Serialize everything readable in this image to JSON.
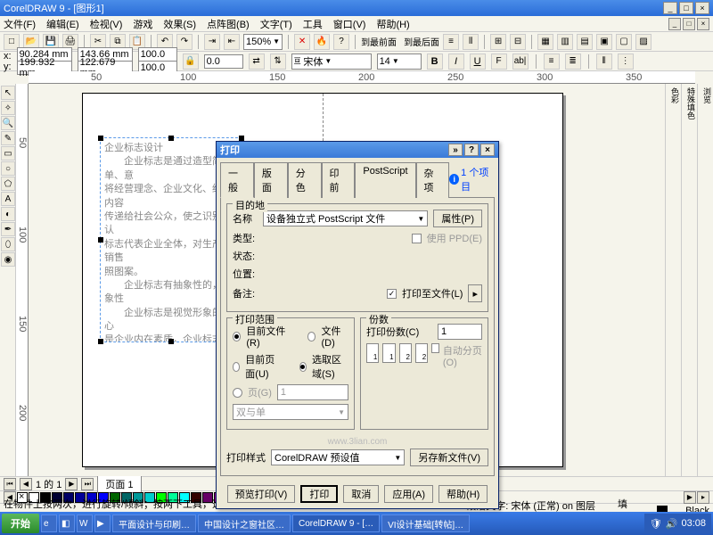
{
  "title": "CorelDRAW 9 - [图形1]",
  "menu": [
    "文件(F)",
    "编辑(E)",
    "检视(V)",
    "游戏",
    "效果(S)",
    "点阵图(B)",
    "文字(T)",
    "工具",
    "窗口(V)",
    "帮助(H)"
  ],
  "toolbar": {
    "zoom": "150%"
  },
  "toolbar2": {
    "t1": "到最前面",
    "t2": "到最后面"
  },
  "prop": {
    "x": "90.284 mm",
    "y": "199.932 mm",
    "w": "143.66 mm",
    "h": "122.679 mm",
    "sx": "100.0",
    "sy": "100.0",
    "rot": "0.0",
    "font": "宋体",
    "size": "14"
  },
  "ruler_h": [
    "50",
    "100",
    "150",
    "200",
    "250",
    "300",
    "350"
  ],
  "ruler_v": [
    "50",
    "100",
    "150",
    "200"
  ],
  "textblock": {
    "title": "企业标志设计",
    "body": "　　企业标志是通过造型简单、意\n将经营理念、企业文化、经营内容\n传递给社会公众，使之识别和认\n标志代表企业全体，对生产、销售\n照图案。\n　　企业标志有抽象性的，具象性\n　　企业标志是视觉形象的核心\n是企业内在素质，企业标志不仅是\n也是整合所有视觉要素的中心。是\n表，因此，企业标志设计，在整\n的意义。\n　　企业标志有如下特征：\n　　（一）识别性\n　　识别性是企业标志的基本功能"
  },
  "dialog": {
    "title": "打印",
    "tabs": [
      "一般",
      "版面",
      "分色",
      "印前",
      "PostScript",
      "杂项"
    ],
    "tab_info": "1 个项目",
    "dest": {
      "label": "目的地",
      "name_l": "名称",
      "name_v": "设备独立式 PostScript 文件",
      "props": "属性(P)",
      "type_l": "类型:",
      "status_l": "状态:",
      "where_l": "位置:",
      "comment_l": "备注:",
      "useppd": "使用 PPD(E)",
      "tofile": "打印至文件(L)"
    },
    "range": {
      "label": "打印范围",
      "curdoc": "目前文件(R)",
      "docs": "文件(D)",
      "curpage": "目前页面(U)",
      "selection": "选取区域(S)",
      "pages": "页(G)",
      "oddeven": "双与单"
    },
    "copies": {
      "label": "份数",
      "count_l": "打印份数(C)",
      "count": "1",
      "collate": "自动分页(O)"
    },
    "style": {
      "label": "打印样式",
      "value": "CorelDRAW 预设值",
      "saveas": "另存新文件(V)"
    },
    "buttons": {
      "preview": "预览打印(V)",
      "print": "打印",
      "cancel": "取消",
      "apply": "应用(A)",
      "help": "帮助(H)"
    },
    "url": "www.3lian.com"
  },
  "pagenav": {
    "of": "1 的 1",
    "pagetab": "页面  1"
  },
  "status": {
    "hint": "在物件上按两次，进行旋转/倾斜；按两下工具，选取全部物件；按住 Shift 键并按一下鼠标，进行多重选...",
    "para": "段落文字: 宋体 (正常) on 图层 1",
    "fill_l": "填色:",
    "fill_v": "Black"
  },
  "colors": [
    "#fff",
    "#000",
    "#003",
    "#006",
    "#009",
    "#00c",
    "#00f",
    "#060",
    "#066",
    "#099",
    "#0cc",
    "#0f0",
    "#0f9",
    "#0ff",
    "#300",
    "#606",
    "#909",
    "#939",
    "#c0c",
    "#f0f",
    "#600",
    "#900",
    "#c00",
    "#f00",
    "#f60",
    "#f90",
    "#fc0",
    "#ff0",
    "#ff9",
    "#ffc",
    "#cfc",
    "#cff",
    "#ccf",
    "#fcf",
    "#ccc",
    "#999",
    "#666",
    "#333"
  ],
  "taskbar": {
    "start": "开始",
    "items": [
      "平面设计与印刷…",
      "中国设计之窗社区…",
      "CorelDRAW 9 - […",
      "VI设计基础[转帖]…"
    ],
    "time": "03:08"
  }
}
